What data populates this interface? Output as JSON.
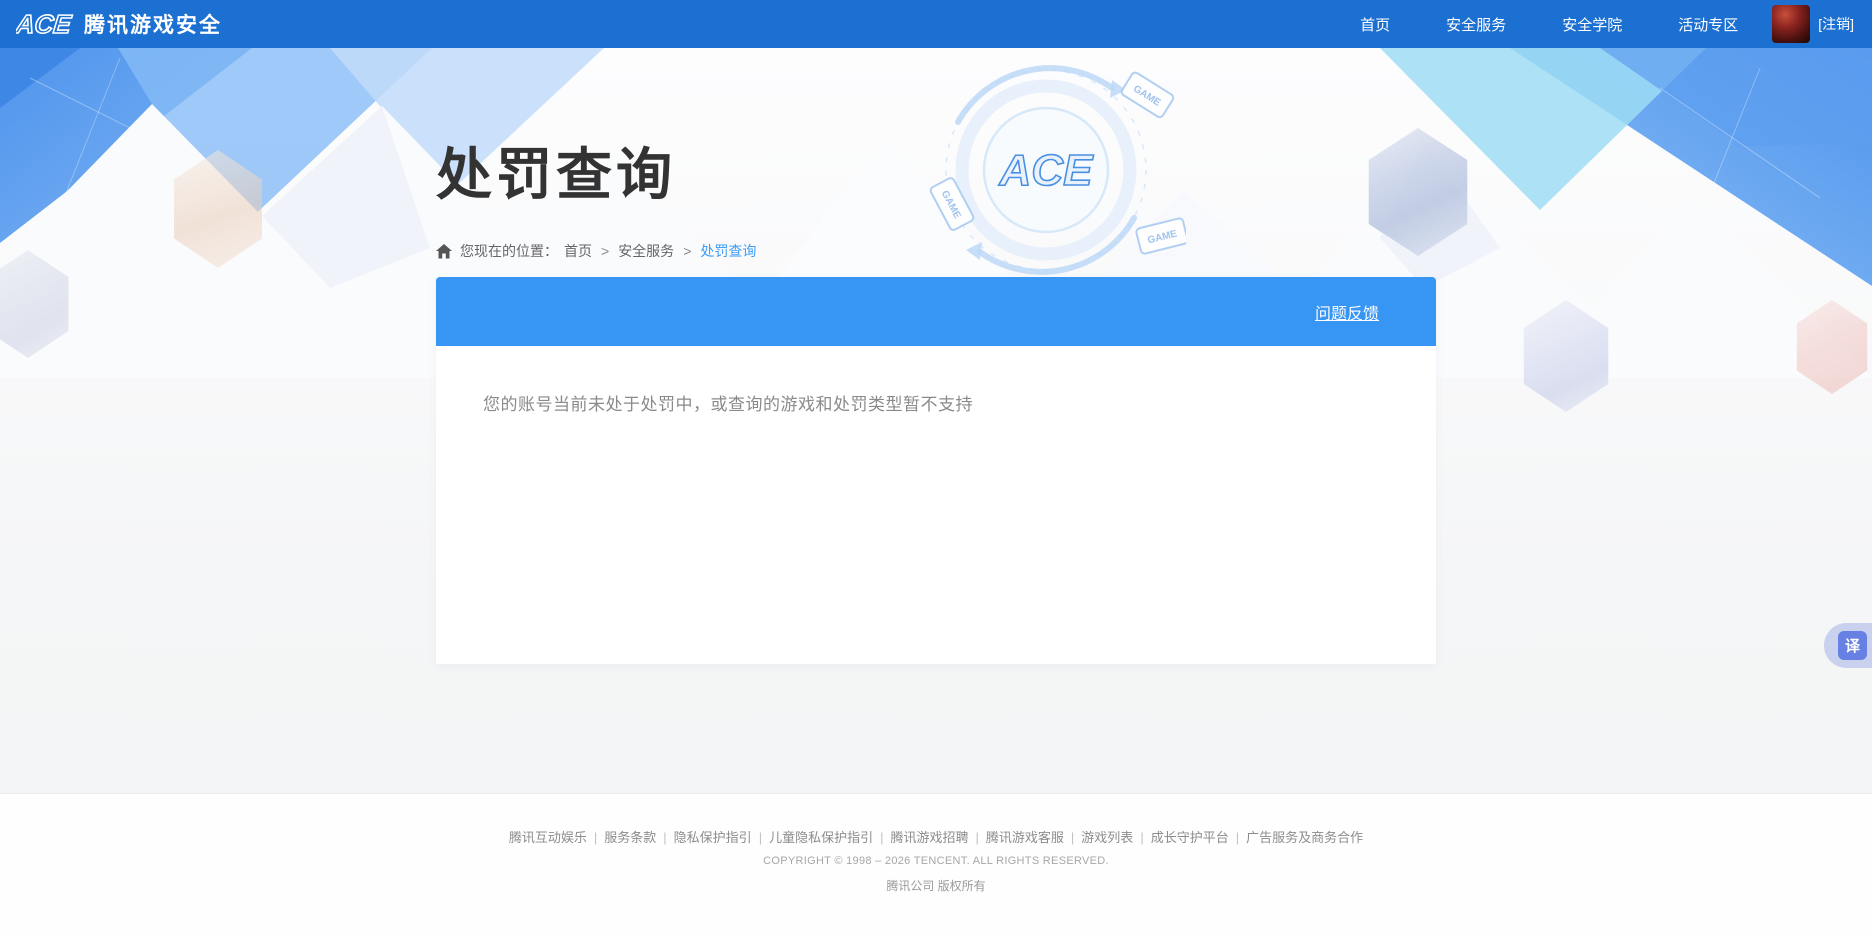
{
  "navbar": {
    "logo_ace": "ACE",
    "logo_text": "腾讯游戏安全",
    "items": [
      {
        "label": "首页"
      },
      {
        "label": "安全服务"
      },
      {
        "label": "安全学院"
      },
      {
        "label": "活动专区"
      }
    ],
    "logout_label": "[注销]"
  },
  "hero": {
    "title": "处罚查询",
    "emblem_text": "ACE",
    "game_tag": "GAME",
    "breadcrumb": {
      "prefix": "您现在的位置：",
      "home": "首页",
      "section": "安全服务",
      "current": "处罚查询",
      "separator": ">"
    }
  },
  "panel": {
    "feedback_link": "问题反馈",
    "message": "您的账号当前未处于处罚中，或查询的游戏和处罚类型暂不支持"
  },
  "footer": {
    "separator": "|",
    "links": [
      "腾讯互动娱乐",
      "服务条款",
      "隐私保护指引",
      "儿童隐私保护指引",
      "腾讯游戏招聘",
      "腾讯游戏客服",
      "游戏列表",
      "成长守护平台",
      "广告服务及商务合作"
    ],
    "copyright": "COPYRIGHT © 1998 – 2026 TENCENT. ALL RIGHTS RESERVED.",
    "company": "腾讯公司 版权所有"
  },
  "translate": {
    "label": "译"
  },
  "colors": {
    "navbar_blue": "#1c70d2",
    "panel_bar_blue": "#3795f4",
    "breadcrumb_active_blue": "#3c9cf6",
    "translate_pill": "#c9d1ee",
    "translate_square": "#6780e3"
  }
}
